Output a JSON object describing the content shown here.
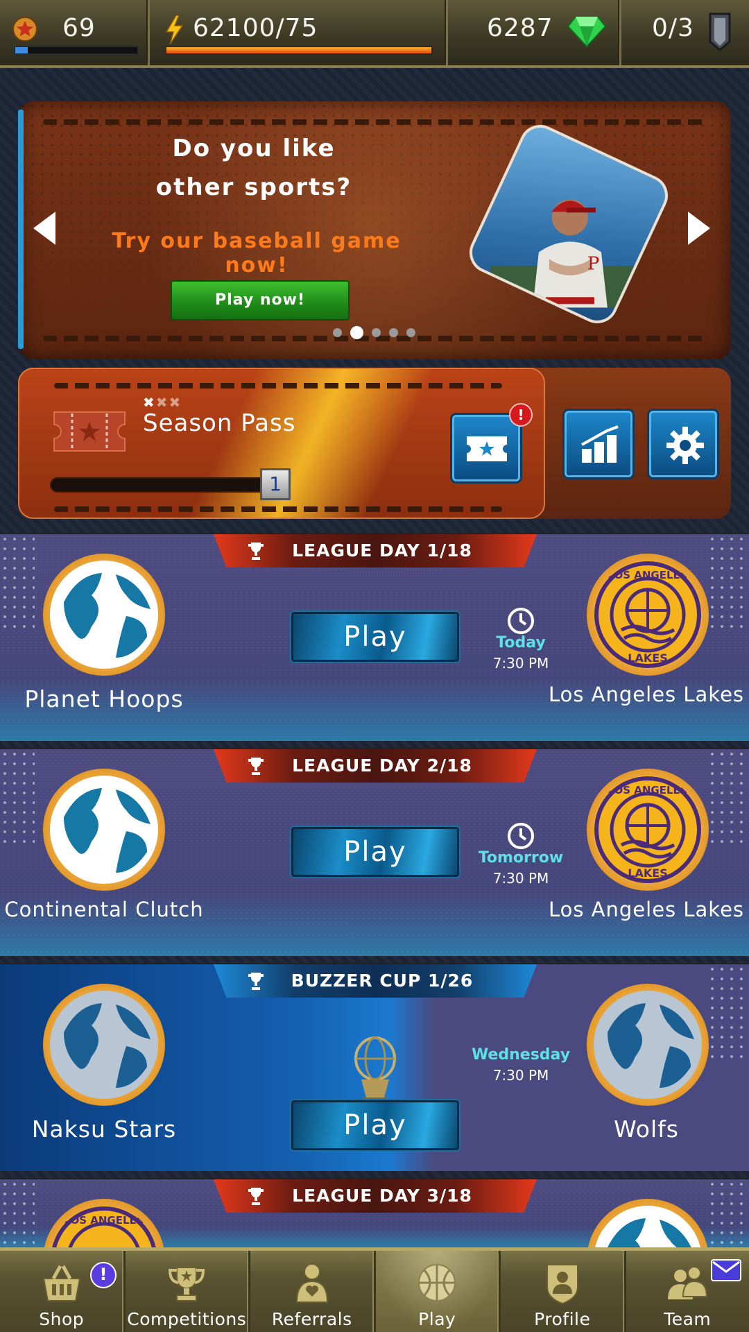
{
  "topbar": {
    "level": "69",
    "level_progress": 0.1,
    "energy": "62100/75",
    "energy_progress": 1.0,
    "gems": "6287",
    "shields": "0/3"
  },
  "promo": {
    "title_line1": "Do you like",
    "title_line2": "other sports?",
    "subtitle": "Try our baseball game now!",
    "button": "Play now!",
    "slide_count": 5,
    "active_slide": 2
  },
  "season_pass": {
    "title": "Season Pass",
    "level": "1",
    "notification": "!"
  },
  "matches": [
    {
      "header": "LEAGUE DAY 1/18",
      "home": "Planet Hoops",
      "away": "Los Angeles Lakes",
      "play": "Play",
      "day": "Today",
      "time": "7:30 PM"
    },
    {
      "header": "LEAGUE DAY 2/18",
      "home": "Continental Clutch",
      "away": "Los Angeles Lakes",
      "play": "Play",
      "day": "Tomorrow",
      "time": "7:30 PM"
    },
    {
      "header": "BUZZER CUP 1/26",
      "home": "Naksu Stars",
      "away": "Wolfs",
      "play": "Play",
      "day": "Wednesday",
      "time": "7:30 PM"
    },
    {
      "header": "LEAGUE DAY 3/18"
    }
  ],
  "logo_text": {
    "top": "LOS ANGELES",
    "bottom": "LAKES"
  },
  "nav": {
    "items": [
      {
        "label": "Shop",
        "icon": "basket-icon",
        "badge": "!"
      },
      {
        "label": "Competitions",
        "icon": "trophy-stars-icon"
      },
      {
        "label": "Referrals",
        "icon": "person-heart-icon"
      },
      {
        "label": "Play",
        "icon": "basketball-icon"
      },
      {
        "label": "Profile",
        "icon": "profile-shield-icon"
      },
      {
        "label": "Team",
        "icon": "team-icon"
      }
    ],
    "active": "Play"
  },
  "colors": {
    "accent_orange": "#ff7a1a",
    "play_green": "#1e8a18",
    "play_blue": "#1b8dc8",
    "league_red": "#e4391c",
    "cup_blue": "#1e8ad8",
    "day_cyan": "#5fe0e6",
    "badge_purple": "#5a3ce0"
  }
}
